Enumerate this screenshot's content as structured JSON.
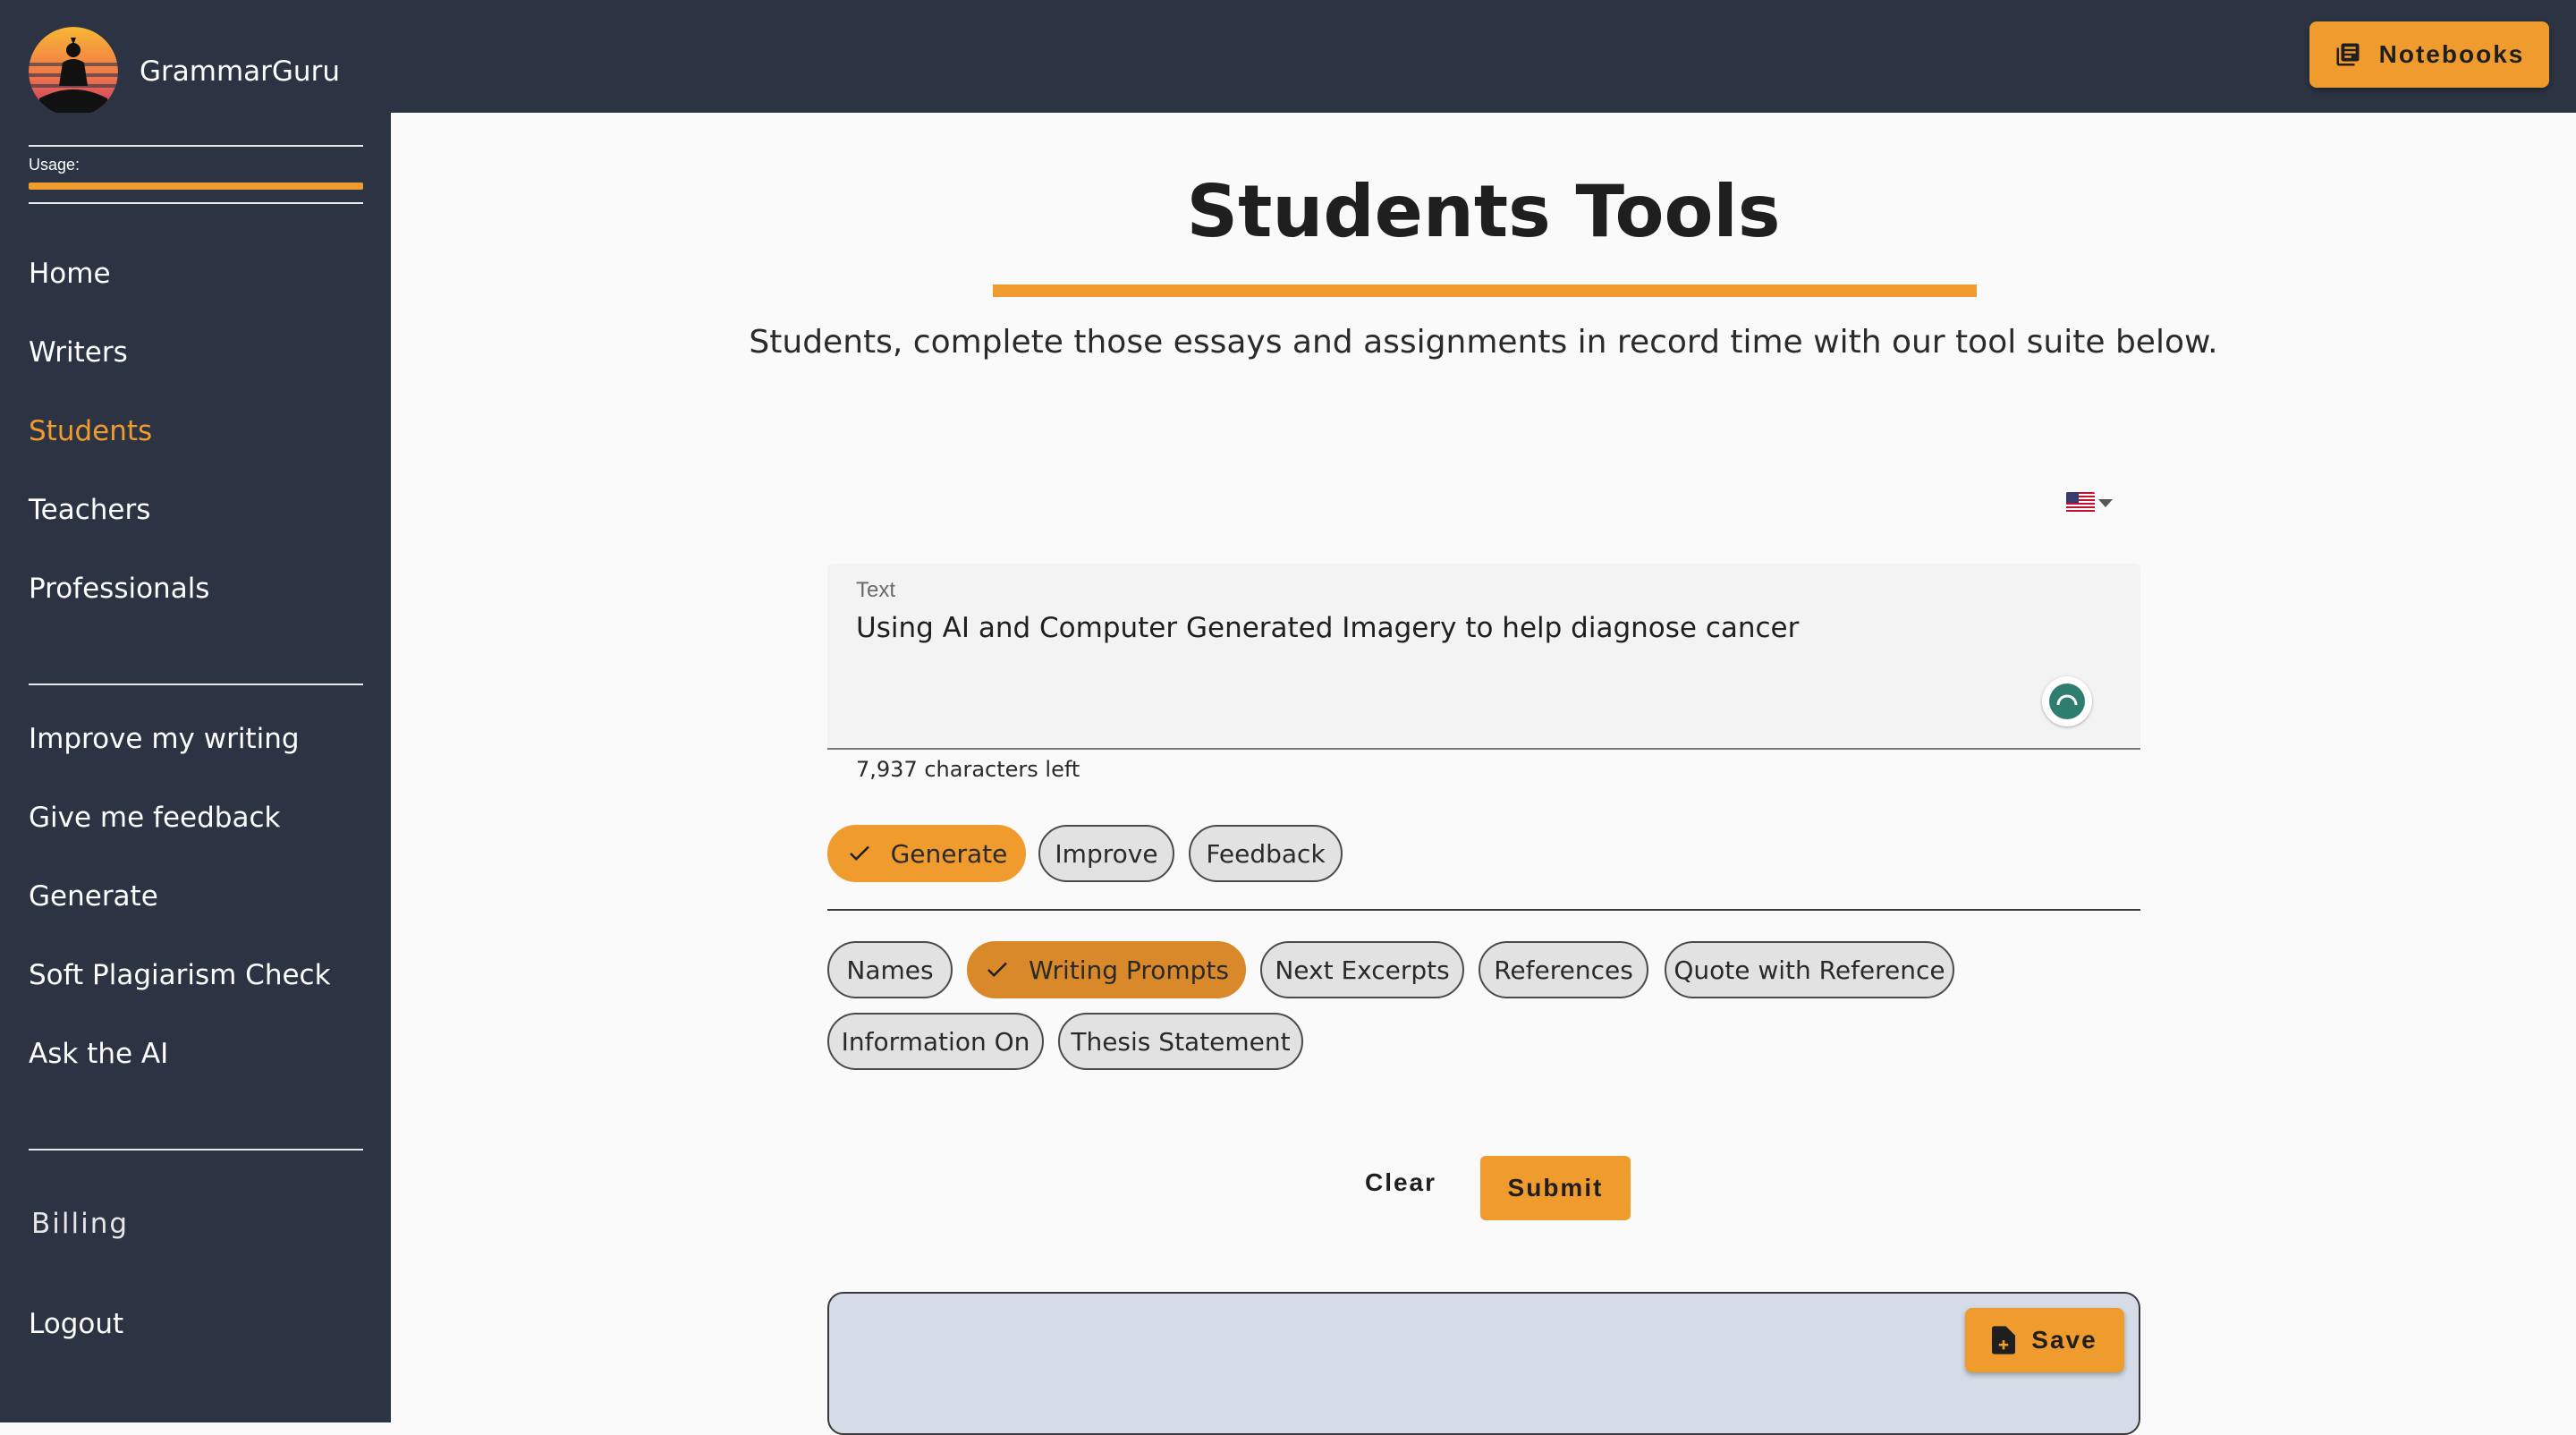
{
  "app": {
    "name": "GrammarGuru"
  },
  "header": {
    "notebooks_label": "Notebooks",
    "notebooks_icon": "notebook-icon"
  },
  "sidebar": {
    "usage_label": "Usage:",
    "usage_fraction": 1.0,
    "nav_primary": [
      {
        "label": "Home"
      },
      {
        "label": "Writers"
      },
      {
        "label": "Students",
        "active": true
      },
      {
        "label": "Teachers"
      },
      {
        "label": "Professionals"
      }
    ],
    "nav_tools": [
      {
        "label": "Improve my writing"
      },
      {
        "label": "Give me feedback"
      },
      {
        "label": "Generate"
      },
      {
        "label": "Soft Plagiarism Check"
      },
      {
        "label": "Ask the AI"
      }
    ],
    "billing_label": "Billing",
    "logout_label": "Logout"
  },
  "main": {
    "title": "Students Tools",
    "subtitle": "Students, complete those essays and assignments in record time with our tool suite below.",
    "language": {
      "icon": "us-flag-icon"
    },
    "text_field": {
      "label": "Text",
      "value": "Using AI and Computer Generated Imagery to help diagnose cancer",
      "char_count": "7,937 characters left"
    },
    "modes": [
      {
        "label": "Generate",
        "selected": true
      },
      {
        "label": "Improve"
      },
      {
        "label": "Feedback"
      }
    ],
    "generate_types": [
      {
        "label": "Names"
      },
      {
        "label": "Writing Prompts",
        "selected": true
      },
      {
        "label": "Next Excerpts"
      },
      {
        "label": "References"
      },
      {
        "label": "Quote with Reference"
      },
      {
        "label": "Information On"
      },
      {
        "label": "Thesis Statement"
      }
    ],
    "clear_label": "Clear",
    "submit_label": "Submit",
    "save_label": "Save"
  },
  "colors": {
    "accent": "#f09b2e",
    "sidebar_bg": "#2c3444",
    "output_bg": "#d5dce7"
  }
}
